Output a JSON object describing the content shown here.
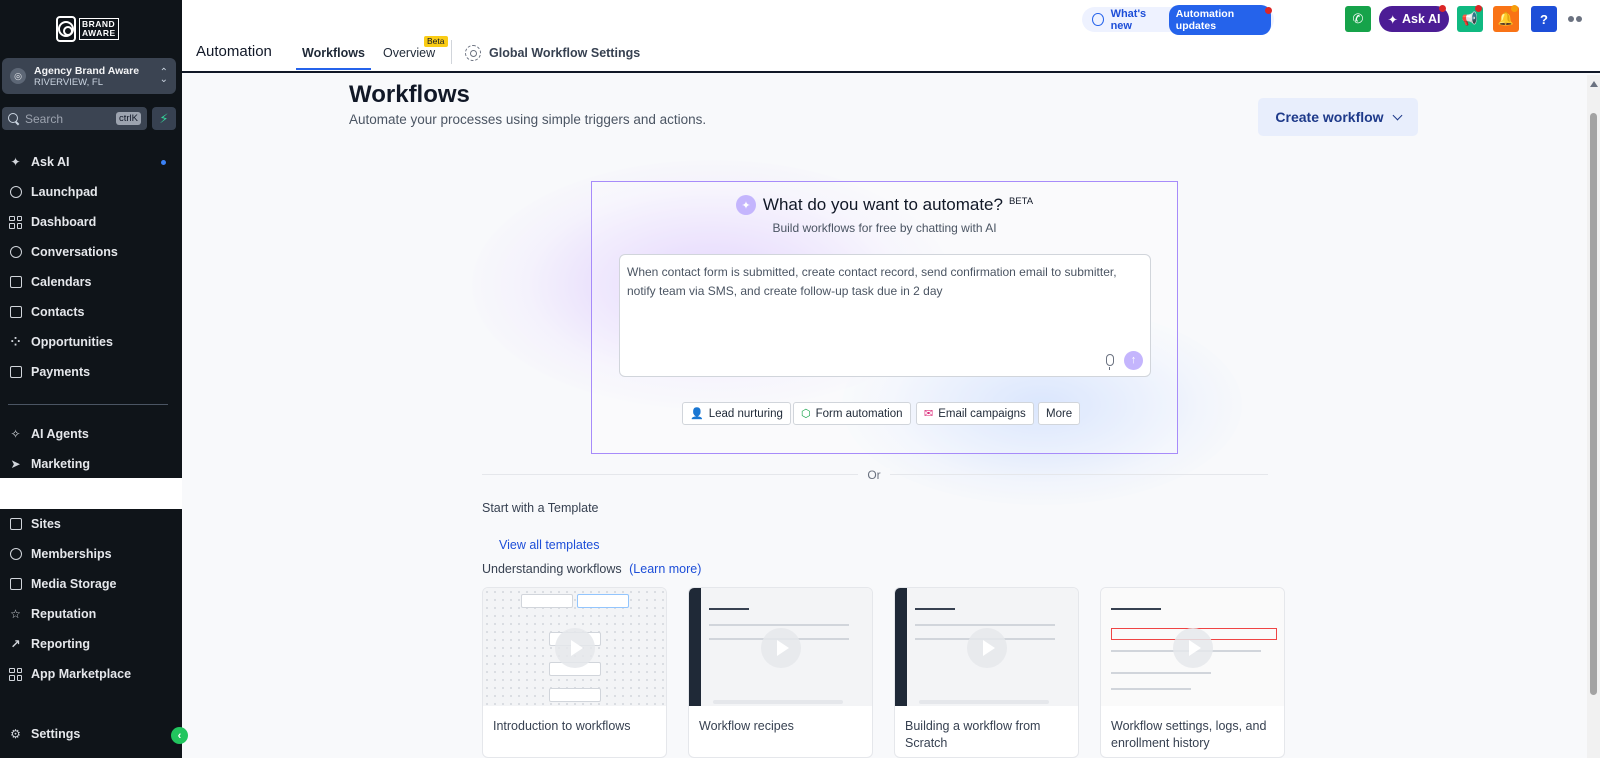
{
  "sidebar": {
    "logo_text": "BRAND AWARE",
    "account": {
      "name": "Agency Brand Aware",
      "location": "RIVERVIEW, FL"
    },
    "search": {
      "label": "Search",
      "shortcut": "ctrlK"
    },
    "items": [
      {
        "label": "Ask AI",
        "icon": "sparkle-icon"
      },
      {
        "label": "Launchpad",
        "icon": "rocket-icon"
      },
      {
        "label": "Dashboard",
        "icon": "grid-icon"
      },
      {
        "label": "Conversations",
        "icon": "chat-icon"
      },
      {
        "label": "Calendars",
        "icon": "calendar-icon"
      },
      {
        "label": "Contacts",
        "icon": "contacts-icon"
      },
      {
        "label": "Opportunities",
        "icon": "funnel-icon"
      },
      {
        "label": "Payments",
        "icon": "receipt-icon"
      },
      {
        "label": "AI Agents",
        "icon": "ai-agent-icon"
      },
      {
        "label": "Marketing",
        "icon": "send-icon"
      },
      {
        "label": "Sites",
        "icon": "globe-icon"
      },
      {
        "label": "Memberships",
        "icon": "badge-icon"
      },
      {
        "label": "Media Storage",
        "icon": "image-icon"
      },
      {
        "label": "Reputation",
        "icon": "star-icon"
      },
      {
        "label": "Reporting",
        "icon": "trend-icon"
      },
      {
        "label": "App Marketplace",
        "icon": "apps-icon"
      },
      {
        "label": "Settings",
        "icon": "gear-icon"
      }
    ]
  },
  "header": {
    "app_title": "Automation",
    "tabs": [
      {
        "label": "Workflows",
        "active": true
      },
      {
        "label": "Overview",
        "badge": "Beta"
      }
    ],
    "settings_tab": "Global Workflow Settings",
    "whats_new": {
      "label": "What's new",
      "pill": "Automation updates"
    },
    "ask_ai": "Ask AI",
    "help": "?"
  },
  "main": {
    "title": "Workflows",
    "subtitle": "Automate your processes using simple triggers and actions.",
    "create_button": "Create workflow",
    "ai_panel": {
      "title": "What do you want to automate?",
      "beta": "BETA",
      "subtitle": "Build workflows for free by chatting with AI",
      "prompt_text": "When contact form is submitted, create contact record, send confirmation email to submitter, notify team via SMS, and create follow-up task due in 2 day",
      "chips": [
        "Lead nurturing",
        "Form automation",
        "Email campaigns",
        "More"
      ]
    },
    "or": "Or",
    "template_heading": "Start with a Template",
    "view_all": "View all templates",
    "understanding": "Understanding workflows",
    "learn_more": "(Learn more)",
    "cards": [
      {
        "title": "Introduction to workflows"
      },
      {
        "title": "Workflow recipes"
      },
      {
        "title": "Building a workflow from Scratch"
      },
      {
        "title": "Workflow settings, logs, and enrollment history"
      }
    ]
  },
  "colors": {
    "accent": "#2563eb",
    "sidebar_bg": "#0f1419",
    "ai_border": "#a78bfa",
    "ask_ai_bg": "#4c1d95"
  }
}
